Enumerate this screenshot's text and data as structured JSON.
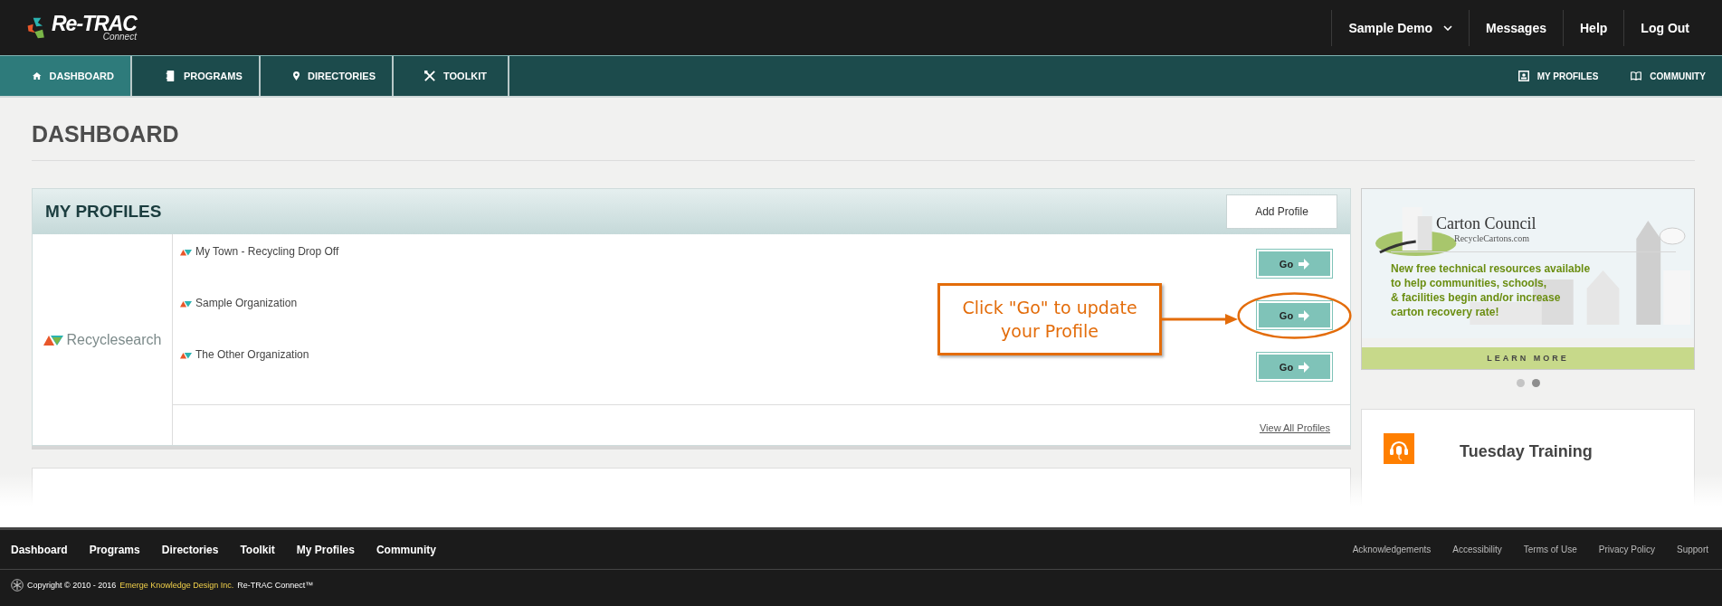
{
  "header": {
    "logo": {
      "name": "Re-TRAC",
      "sub": "Connect"
    },
    "user_menu": "Sample Demo",
    "links": [
      "Messages",
      "Help",
      "Log Out"
    ]
  },
  "nav": {
    "tabs": [
      {
        "label": "DASHBOARD",
        "selected": true
      },
      {
        "label": "PROGRAMS",
        "selected": false
      },
      {
        "label": "DIRECTORIES",
        "selected": false
      },
      {
        "label": "TOOLKIT",
        "selected": false
      }
    ],
    "right_links": [
      {
        "label": "MY PROFILES"
      },
      {
        "label": "COMMUNITY"
      }
    ]
  },
  "page_title": "DASHBOARD",
  "profiles_panel": {
    "title": "MY PROFILES",
    "add_button": "Add Profile",
    "source": "Recyclesearch",
    "profiles": [
      {
        "name": "My Town - Recycling Drop Off",
        "button": "Go",
        "circled": false
      },
      {
        "name": "Sample Organization",
        "button": "Go",
        "circled": true
      },
      {
        "name": "The Other Organization",
        "button": "Go",
        "circled": false
      }
    ],
    "view_all": "View All Profiles"
  },
  "callout": {
    "lines": [
      "Click \"Go\" to update",
      "your Profile"
    ]
  },
  "banner": {
    "title": "Carton Council",
    "site": "RecycleCartons.com",
    "message_lines": [
      "New free technical resources available",
      "to help communities, schools,",
      "& facilities begin and/or increase",
      "carton recovery rate!"
    ],
    "action": "LEARN MORE"
  },
  "carousel": {
    "dots": [
      {
        "selected": false
      },
      {
        "selected": true
      }
    ]
  },
  "training": {
    "title": "Tuesday Training"
  },
  "footer": {
    "links": [
      "Dashboard",
      "Programs",
      "Directories",
      "Toolkit",
      "My Profiles",
      "Community"
    ],
    "legal_links": [
      "Acknowledgements",
      "Accessibility",
      "Terms of Use",
      "Privacy Policy",
      "Support"
    ],
    "copyright": {
      "prefix": "Copyright © 2010 - 2016",
      "company": "Emerge Knowledge Design Inc.",
      "suffix": "Re-TRAC Connect™"
    }
  }
}
